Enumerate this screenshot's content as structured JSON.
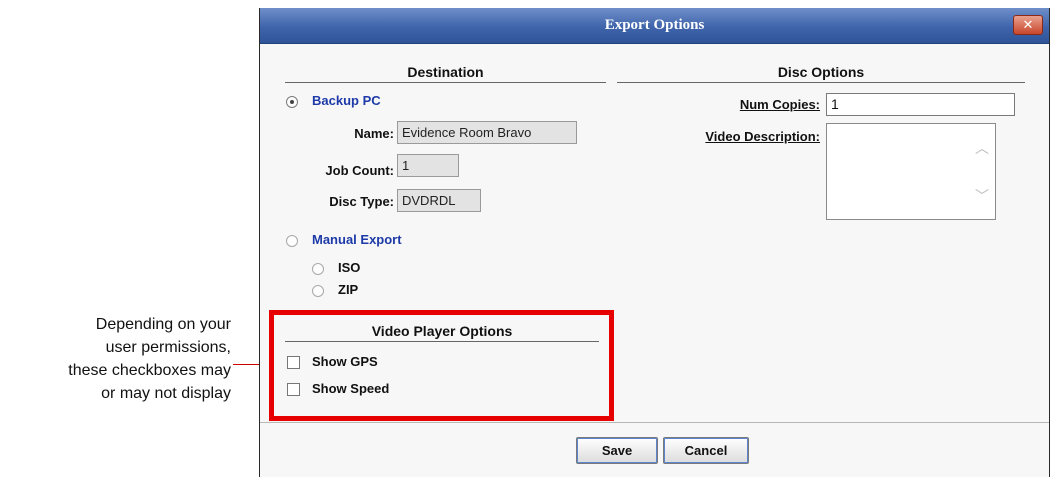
{
  "annotation": {
    "lines": [
      "Depending on your",
      "user permissions,",
      "these checkboxes may",
      "or may not display"
    ]
  },
  "dialog": {
    "title": "Export Options",
    "close_label": "✕",
    "destination": {
      "heading": "Destination",
      "backup_pc": {
        "label": "Backup PC",
        "selected": true
      },
      "name_label": "Name:",
      "name_value": "Evidence Room Bravo",
      "job_count_label": "Job Count:",
      "job_count_value": "1",
      "disc_type_label": "Disc Type:",
      "disc_type_value": "DVDRDL",
      "manual_export": {
        "label": "Manual Export",
        "selected": false
      },
      "iso_label": "ISO",
      "zip_label": "ZIP"
    },
    "disc_options": {
      "heading": "Disc Options",
      "num_copies_label": "Num Copies:",
      "num_copies_value": "1",
      "video_description_label": "Video Description:",
      "video_description_value": ""
    },
    "video_player_options": {
      "heading": "Video Player Options",
      "show_gps_label": "Show GPS",
      "show_gps_checked": false,
      "show_speed_label": "Show Speed",
      "show_speed_checked": false
    },
    "buttons": {
      "save": "Save",
      "cancel": "Cancel"
    }
  },
  "colors": {
    "title_bar": "#3f64ab",
    "highlight_border": "#e60000",
    "option_label": "#1d3aa8"
  }
}
